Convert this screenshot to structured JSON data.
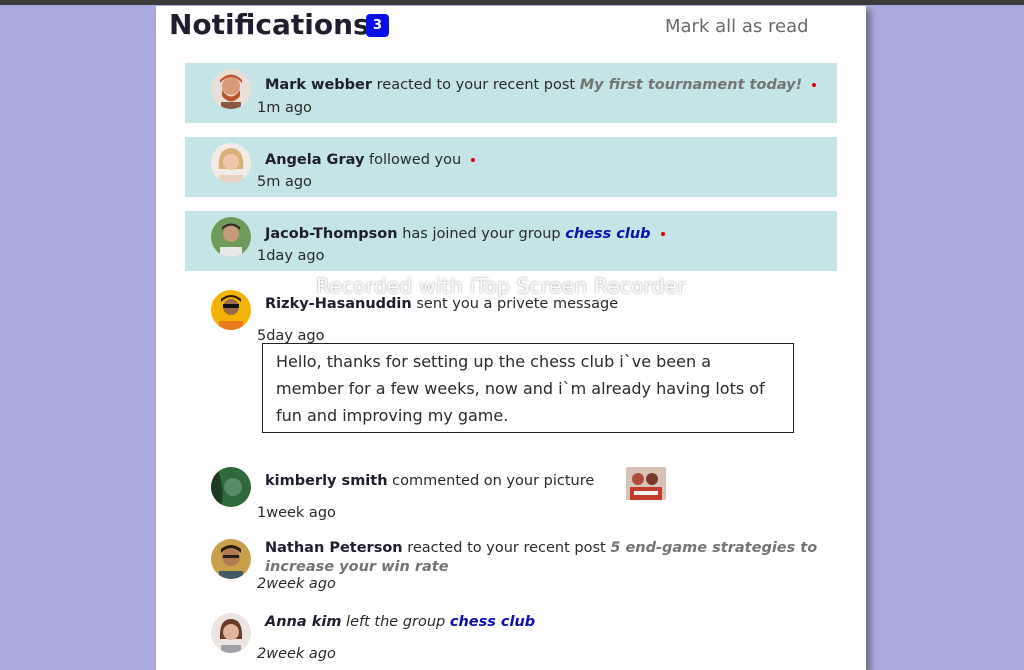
{
  "header": {
    "title": "Notifications",
    "unread_count": "3",
    "mark_all_label": "Mark all as read"
  },
  "notifications": [
    {
      "user": "Mark webber",
      "action": "reacted to your recent post",
      "target": "My first tournament today!",
      "time": "1m ago",
      "unread": true
    },
    {
      "user": "Angela Gray",
      "action": "followed you",
      "time": "5m ago",
      "unread": true
    },
    {
      "user": "Jacob-Thompson",
      "action": "has joined your group",
      "target": "chess club",
      "time": "1day ago",
      "unread": true
    },
    {
      "user": "Rizky-Hasanuddin",
      "action": "sent you a privete message",
      "time": "5day ago",
      "message": "Hello, thanks for setting up the chess club i`ve been a member for a few weeks, now and i`m already having lots of fun and improving my game."
    },
    {
      "user": "kimberly smith",
      "action": "commented on your picture",
      "time": "1week ago"
    },
    {
      "user": "Nathan Peterson",
      "action": "reacted to your recent post",
      "target": "5 end-game strategies to increase your win rate",
      "time": "2week ago"
    },
    {
      "user": "Anna kim",
      "action": "left the group",
      "target": "chess club",
      "time": "2week ago"
    }
  ],
  "watermark": "Recorded with iTop Screen Recorder",
  "colors": {
    "background": "#aaaade",
    "unread_bg": "#c5e4e6",
    "badge": "#0a10e6",
    "group_link": "#0a10b0",
    "unread_dot": "#e00000"
  }
}
